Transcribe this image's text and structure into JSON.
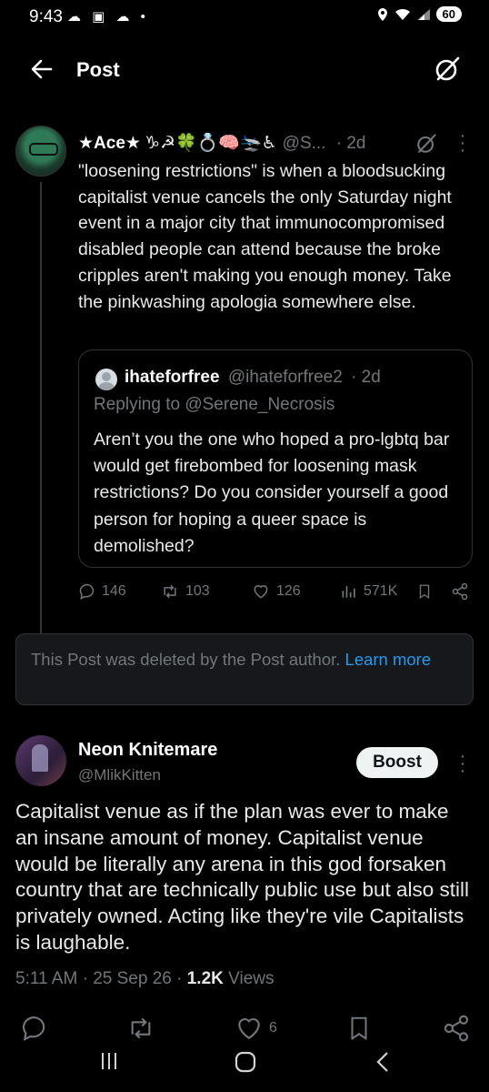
{
  "status_bar": {
    "time": "9:43",
    "battery": "60"
  },
  "header": {
    "title": "Post"
  },
  "post": {
    "display_name": "★Ace★",
    "emoji_badges": "♑☭🍀💍🧠🛬♿",
    "handle": "@S...",
    "time": "· 2d",
    "text": "\"loosening restrictions\" is when a bloodsucking capitalist venue cancels the only Saturday night event in a major city that immunocompromised disabled people can attend because the broke cripples aren't making you enough money. Take the pinkwashing apologia somewhere else.",
    "quote": {
      "display_name": "ihateforfree",
      "handle": "@ihateforfree2",
      "time": "· 2d",
      "replying_prefix": "Replying to ",
      "replying_to": "@Serene_Necrosis",
      "text": "Aren’t you the one who hoped a pro-lgbtq bar would get firebombed for loosening mask restrictions? Do you consider yourself a good person for hoping a queer space is demolished?"
    },
    "stats": {
      "replies": "146",
      "reposts": "103",
      "likes": "126",
      "views": "571K"
    }
  },
  "deleted_notice": {
    "text": "This Post was deleted by the Post author. ",
    "link": "Learn more"
  },
  "reply": {
    "display_name": "Neon Knitemare",
    "handle": "@MlikKitten",
    "boost_label": "Boost",
    "text": "Capitalist venue as if the plan was ever to make an insane amount of money. Capitalist venue would be literally any arena in this god forsaken country that are technically public use but also still privately owned. Acting like they're vile Capitalists is laughable.",
    "time": "5:11 AM",
    "date": "25 Sep 26",
    "views_count": "1.2K",
    "views_label": "Views",
    "likes": "6"
  },
  "colors": {
    "background": "#000000",
    "text": "#e7e9ea",
    "muted": "#71767b",
    "link": "#1d9bf0",
    "border": "#2f3336"
  }
}
